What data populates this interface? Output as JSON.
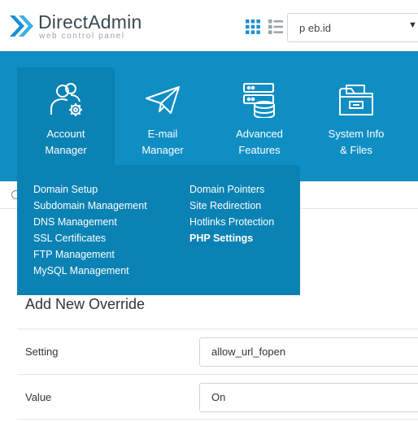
{
  "brand": {
    "title": "DirectAdmin",
    "subtitle": "web control panel"
  },
  "header": {
    "domain": "p          eb.id"
  },
  "nav": {
    "items": [
      {
        "line1": "Account",
        "line2": "Manager"
      },
      {
        "line1": "E-mail",
        "line2": "Manager"
      },
      {
        "line1": "Advanced",
        "line2": "Features"
      },
      {
        "line1": "System Info",
        "line2": "& Files"
      }
    ]
  },
  "menu": {
    "left": [
      "Domain Setup",
      "Subdomain Management",
      "DNS Management",
      "SSL Certificates",
      "FTP Management",
      "MySQL Management"
    ],
    "right": [
      "Domain Pointers",
      "Site Redirection",
      "Hotlinks Protection",
      "PHP Settings"
    ]
  },
  "form": {
    "title": "Add New Override",
    "setting_label": "Setting",
    "setting_value": "allow_url_fopen",
    "value_label": "Value",
    "value_value": "On"
  },
  "colors": {
    "nav_background": "#0f8ec4",
    "nav_active": "#0b82b4",
    "logo_accent": "#1b8fd0"
  }
}
